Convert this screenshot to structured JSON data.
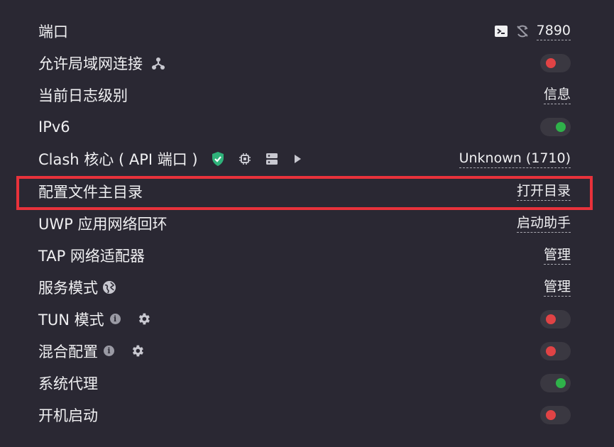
{
  "rows": {
    "port": {
      "label": "端口",
      "value": "7890",
      "icons": [
        "terminal-icon",
        "shuffle-icon"
      ]
    },
    "allow_lan": {
      "label": "允许局域网连接",
      "toggle": "off",
      "icons": [
        "network-icon"
      ]
    },
    "log_level": {
      "label": "当前日志级别",
      "value": "信息"
    },
    "ipv6": {
      "label": "IPv6",
      "toggle": "on"
    },
    "clash_core": {
      "label": "Clash 核心 ( API 端口 )",
      "value": "Unknown (1710)",
      "icons": [
        "shield-check-icon",
        "chip-icon",
        "server-icon",
        "play-icon"
      ]
    },
    "config_dir": {
      "label": "配置文件主目录",
      "value": "打开目录"
    },
    "uwp_loopback": {
      "label": "UWP 应用网络回环",
      "value": "启动助手"
    },
    "tap_adapter": {
      "label": "TAP 网络适配器",
      "value": "管理"
    },
    "service_mode": {
      "label": "服务模式",
      "value": "管理",
      "icons": [
        "globe-icon"
      ]
    },
    "tun_mode": {
      "label": "TUN 模式",
      "toggle": "off",
      "icons": [
        "info-icon",
        "gear-icon"
      ]
    },
    "mixin": {
      "label": "混合配置",
      "toggle": "off",
      "icons": [
        "info-icon",
        "gear-icon"
      ]
    },
    "system_proxy": {
      "label": "系统代理",
      "toggle": "on"
    },
    "auto_start": {
      "label": "开机启动",
      "toggle": "off"
    }
  },
  "colors": {
    "background": "#2a2833",
    "toggle_on": "#2fb24a",
    "toggle_off": "#e04345",
    "shield": "#2fb27a",
    "highlight": "#e8323b"
  }
}
